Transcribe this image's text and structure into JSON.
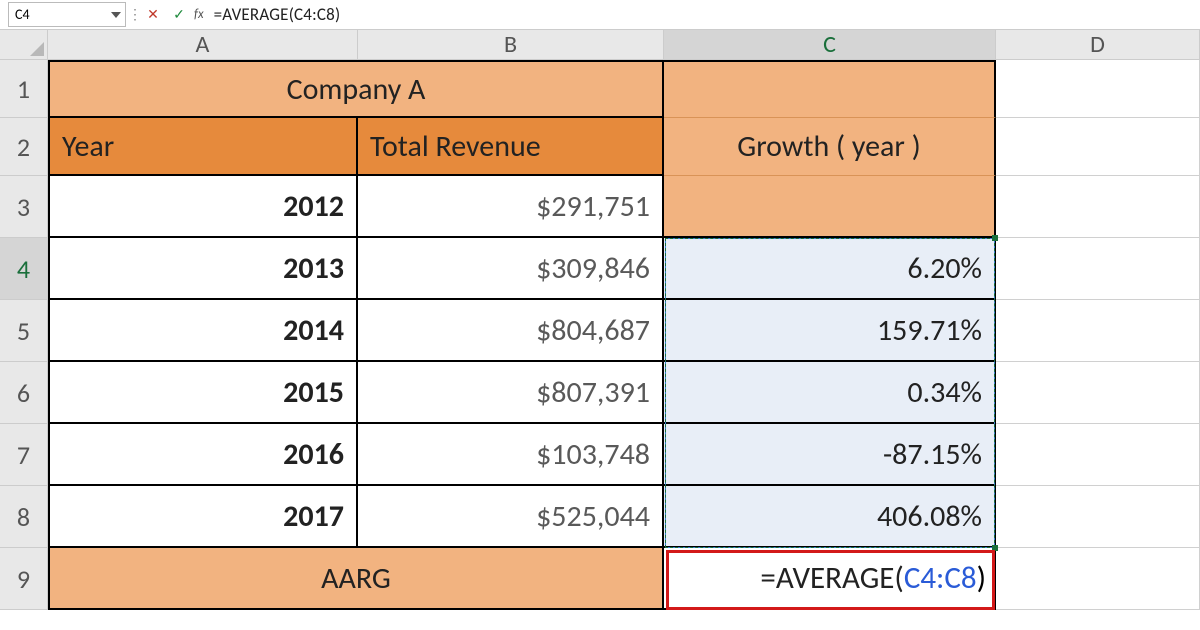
{
  "formula_bar": {
    "name_box": "C4",
    "cancel_glyph": "✕",
    "accept_glyph": "✓",
    "fx_label": "fx",
    "formula_text": "=AVERAGE(C4:C8)"
  },
  "col_headers": [
    "A",
    "B",
    "C",
    "D"
  ],
  "row_headers": [
    "1",
    "2",
    "3",
    "4",
    "5",
    "6",
    "7",
    "8",
    "9"
  ],
  "cells": {
    "company_title": "Company A",
    "header_year": "Year",
    "header_revenue": "Total Revenue",
    "header_growth": "Growth ( year )",
    "aarg_label": "AARG",
    "years": [
      "2012",
      "2013",
      "2014",
      "2015",
      "2016",
      "2017"
    ],
    "revenues": [
      "$291,751",
      "$309,846",
      "$804,687",
      "$807,391",
      "$103,748",
      "$525,044"
    ],
    "growth": [
      "",
      "6.20%",
      "159.71%",
      "0.34%",
      "-87.15%",
      "406.08%"
    ],
    "c9_prefix": "=AVERAGE(",
    "c9_ref": "C4:C8",
    "c9_suffix": ")"
  },
  "chart_data": {
    "type": "table",
    "title": "Company A",
    "columns": [
      "Year",
      "Total Revenue",
      "Growth ( year )"
    ],
    "rows": [
      {
        "Year": 2012,
        "Total Revenue": 291751,
        "Growth ( year )": null
      },
      {
        "Year": 2013,
        "Total Revenue": 309846,
        "Growth ( year )": 0.062
      },
      {
        "Year": 2014,
        "Total Revenue": 804687,
        "Growth ( year )": 1.5971
      },
      {
        "Year": 2015,
        "Total Revenue": 807391,
        "Growth ( year )": 0.0034
      },
      {
        "Year": 2016,
        "Total Revenue": 103748,
        "Growth ( year )": -0.8715
      },
      {
        "Year": 2017,
        "Total Revenue": 525044,
        "Growth ( year )": 4.0608
      }
    ],
    "footer": {
      "label": "AARG",
      "formula": "=AVERAGE(C4:C8)"
    }
  }
}
